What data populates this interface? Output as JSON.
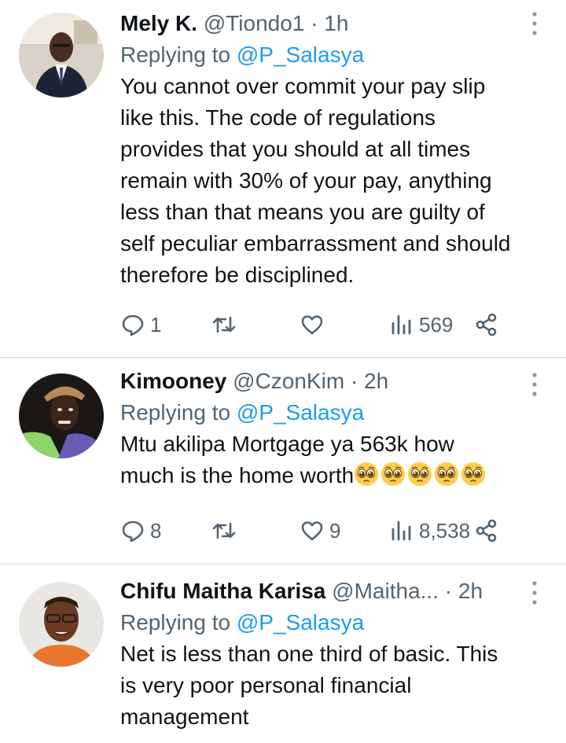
{
  "tweets": [
    {
      "name": "Mely K.",
      "handle": "@Tiondo1",
      "dot": "·",
      "time": "1h",
      "replying_prefix": "Replying to",
      "replying_to": "@P_Salasya",
      "lines": [
        "You cannot over commit your pay slip",
        "like this. The code of regulations",
        "provides that you should at all times",
        "remain with 30% of your pay, anything",
        "less than that means you are guilty of",
        "self peculiar embarrassment and should",
        "therefore be disciplined."
      ],
      "reply_count": "1",
      "retweet_count": "",
      "like_count": "",
      "view_count": "569"
    },
    {
      "name": "Kimooney",
      "handle": "@CzonKim",
      "dot": "·",
      "time": "2h",
      "replying_prefix": "Replying to",
      "replying_to": "@P_Salasya",
      "lines": [
        "Mtu akilipa Mortgage ya 563k how",
        "much is the home worth"
      ],
      "emoji": "pleading-face x5",
      "reply_count": "8",
      "retweet_count": "",
      "like_count": "9",
      "view_count": "8,538"
    },
    {
      "name": "Chifu Maitha Karisa",
      "handle": "@Maitha...",
      "dot": "·",
      "time": "2h",
      "replying_prefix": "Replying to",
      "replying_to": "@P_Salasya",
      "lines": [
        "Net is less than one third of basic. This",
        "is very poor personal financial",
        "management"
      ]
    }
  ],
  "icons": {
    "reply": "reply-icon",
    "retweet": "retweet-icon",
    "like": "like-icon",
    "views": "views-icon",
    "share": "share-icon",
    "more": "more-vertical-icon"
  },
  "colors": {
    "text": "#0f1419",
    "secondary": "#536471",
    "link": "#1d9bf0",
    "divider": "#cfd9de"
  }
}
